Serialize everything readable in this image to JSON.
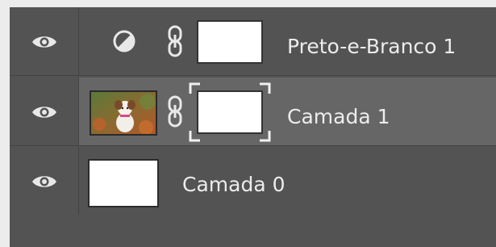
{
  "colors": {
    "panel_bg": "#535353",
    "selected_row_bg": "#666666",
    "row_divider": "#434343",
    "text": "#ececec"
  },
  "layers": [
    {
      "name": "Preto-e-Branco 1",
      "type": "adjustment",
      "icon": "half-circle-adjustment-icon",
      "visible": true,
      "linked": true,
      "mask": "white",
      "selected": false
    },
    {
      "name": "Camada 1",
      "type": "pixel",
      "thumbnail": "puppy-photo-thumbnail",
      "visible": true,
      "linked": true,
      "mask": "white",
      "mask_selected": true,
      "selected": true
    },
    {
      "name": "Camada 0",
      "type": "pixel",
      "thumbnail": "white-thumbnail",
      "visible": true,
      "linked": false,
      "selected": false
    }
  ]
}
